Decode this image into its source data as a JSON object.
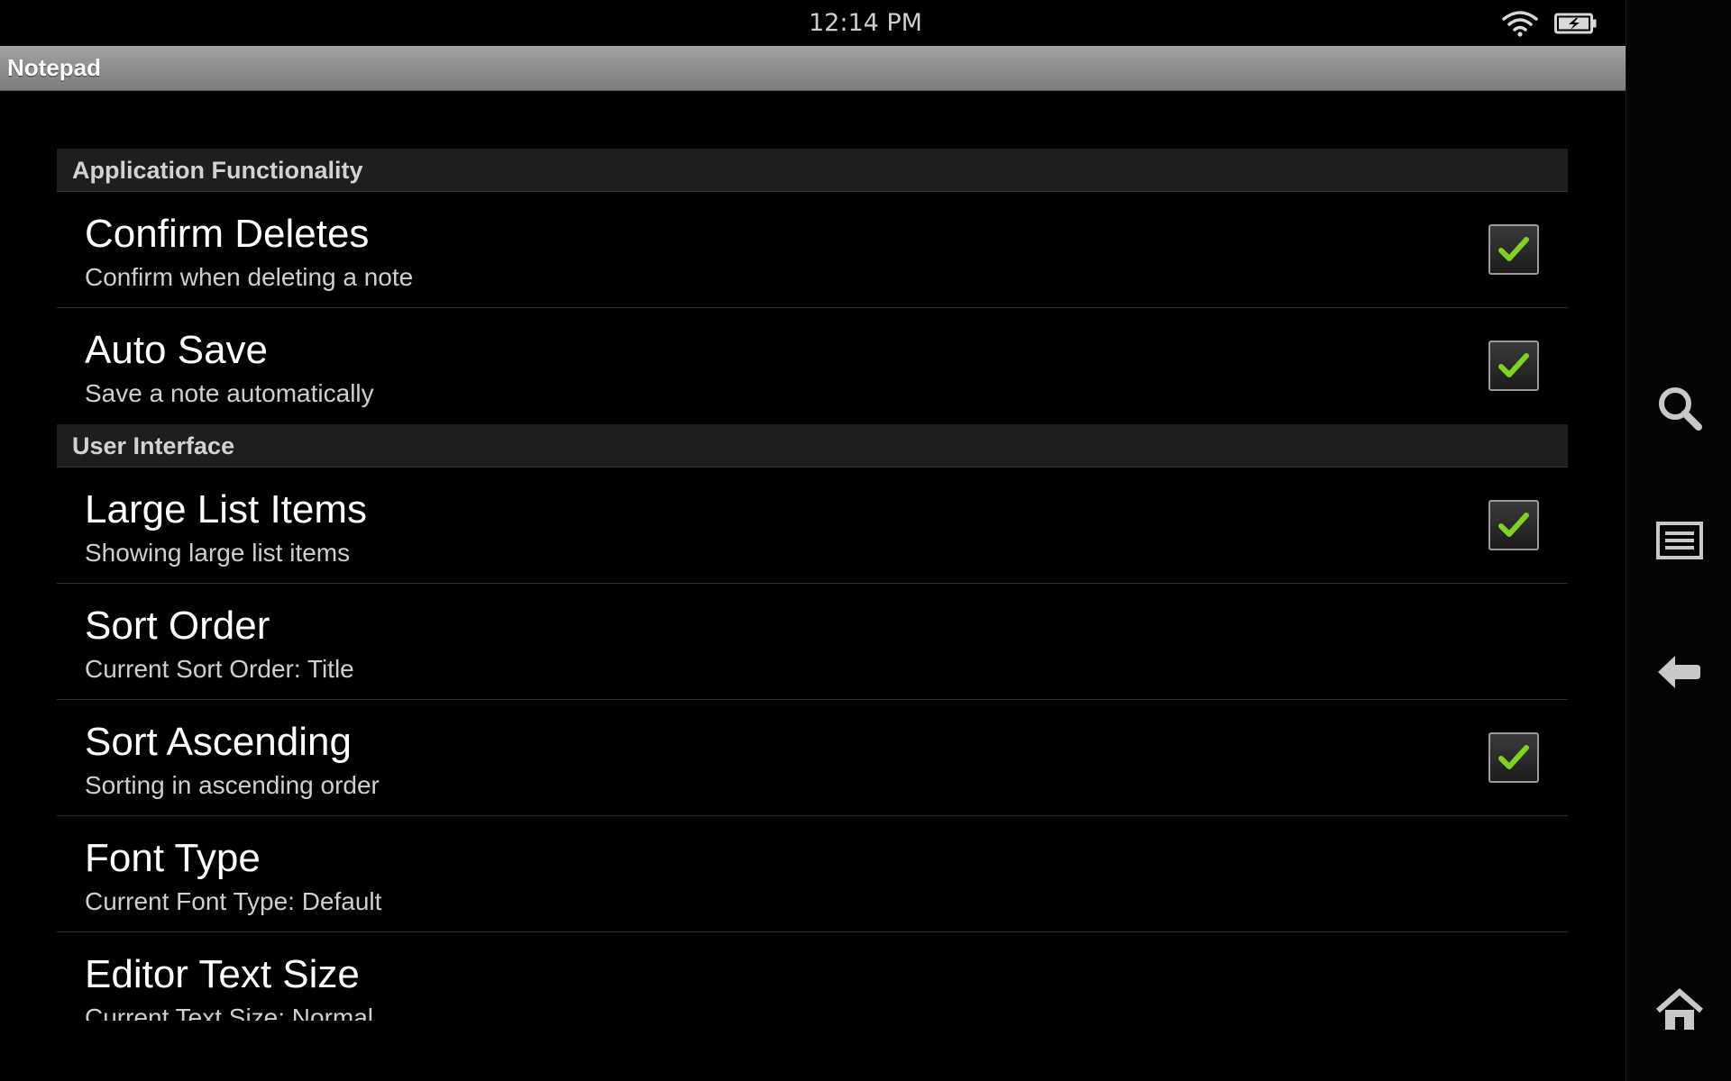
{
  "status_bar": {
    "time": "12:14 PM",
    "wifi_icon": "wifi-icon",
    "battery_icon": "battery-charging-icon"
  },
  "app": {
    "title": "Notepad"
  },
  "colors": {
    "check": "#7ed321",
    "title_bar": "#8a8a8a",
    "category_bg": "#1e1e1e"
  },
  "prefs": {
    "cat_app": "Application Functionality",
    "confirm_deletes": {
      "title": "Confirm Deletes",
      "summary": "Confirm when deleting a note",
      "checked": true
    },
    "auto_save": {
      "title": "Auto Save",
      "summary": "Save a note automatically",
      "checked": true
    },
    "cat_ui": "User Interface",
    "large_list_items": {
      "title": "Large List Items",
      "summary": "Showing large list items",
      "checked": true
    },
    "sort_order": {
      "title": "Sort Order",
      "summary": "Current Sort Order: Title"
    },
    "sort_ascending": {
      "title": "Sort Ascending",
      "summary": "Sorting in ascending order",
      "checked": true
    },
    "font_type": {
      "title": "Font Type",
      "summary": "Current Font Type: Default"
    },
    "editor_text_size": {
      "title": "Editor Text Size",
      "summary": "Current Text Size: Normal"
    }
  },
  "nav": {
    "search": "search-icon",
    "menu": "menu-icon",
    "back": "back-icon",
    "home": "home-icon"
  }
}
